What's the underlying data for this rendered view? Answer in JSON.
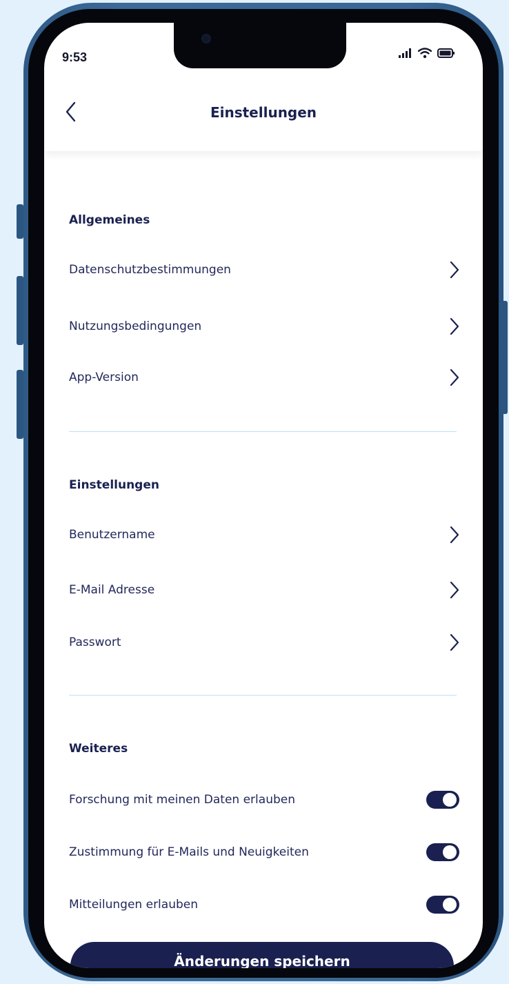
{
  "status_bar": {
    "time": "9:53"
  },
  "header": {
    "title": "Einstellungen"
  },
  "sections": [
    {
      "title": "Allgemeines",
      "items": [
        {
          "label": "Datenschutzbestimmungen"
        },
        {
          "label": "Nutzungsbedingungen"
        },
        {
          "label": "App-Version"
        }
      ]
    },
    {
      "title": "Einstellungen",
      "items": [
        {
          "label": "Benutzername"
        },
        {
          "label": "E-Mail Adresse"
        },
        {
          "label": "Passwort"
        }
      ]
    },
    {
      "title": "Weiteres",
      "toggles": [
        {
          "label": "Forschung mit meinen Daten erlauben",
          "on": true
        },
        {
          "label": "Zustimmung für E-Mails und Neuigkeiten",
          "on": true
        },
        {
          "label": "Mitteilungen erlauben",
          "on": true
        }
      ]
    }
  ],
  "save_button": {
    "label": "Änderungen speichern"
  },
  "colors": {
    "primary": "#1a2150",
    "background": "#e3f1fc",
    "frame": "#3a6896",
    "divider": "#bfe0f5"
  }
}
